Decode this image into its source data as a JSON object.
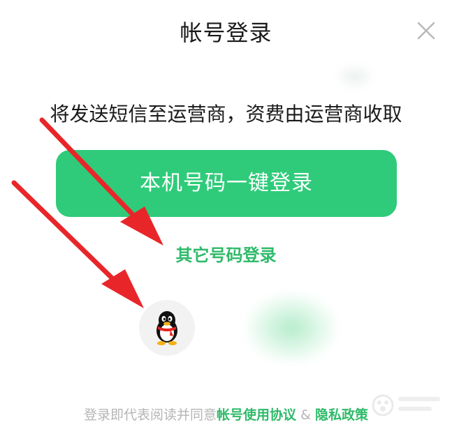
{
  "header": {
    "title": "帐号登录",
    "close_icon": "close-icon"
  },
  "notice": {
    "text": "将发送短信至运营商，资费由运营商收取"
  },
  "primary_button": {
    "label": "本机号码一键登录",
    "color": "#2fcb7a"
  },
  "other_login": {
    "label": "其它号码登录",
    "color": "#2fba6a"
  },
  "third_party": {
    "qq_icon": "qq-penguin-icon"
  },
  "footer": {
    "prefix": "登录即代表阅读并同意",
    "agreement_link": "帐号使用协议",
    "separator": " & ",
    "privacy_link": "隐私政策"
  },
  "annotations": {
    "arrow_color": "#e8262a"
  }
}
